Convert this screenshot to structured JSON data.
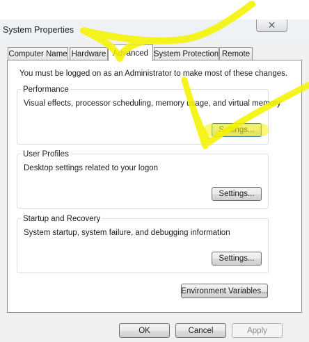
{
  "window": {
    "title": "System Properties",
    "close_symbol": "✕"
  },
  "tabs": [
    {
      "label": "Computer Name"
    },
    {
      "label": "Hardware"
    },
    {
      "label": "Advanced",
      "active": true
    },
    {
      "label": "System Protection"
    },
    {
      "label": "Remote"
    }
  ],
  "notice": "You must be logged on as an Administrator to make most of these changes.",
  "performance": {
    "legend": "Performance",
    "description": "Visual effects, processor scheduling, memory usage, and virtual memory",
    "settings_label": "Settings..."
  },
  "user_profiles": {
    "legend": "User Profiles",
    "description": "Desktop settings related to your logon",
    "settings_label": "Settings..."
  },
  "startup_recovery": {
    "legend": "Startup and Recovery",
    "description": "System startup, system failure, and debugging information",
    "settings_label": "Settings..."
  },
  "env_vars_label": "Environment Variables...",
  "footer": {
    "ok_label": "OK",
    "cancel_label": "Cancel",
    "apply_label": "Apply"
  },
  "colors": {
    "highlight_marker": "#f5f200",
    "focus_border": "#3c7fb1"
  }
}
